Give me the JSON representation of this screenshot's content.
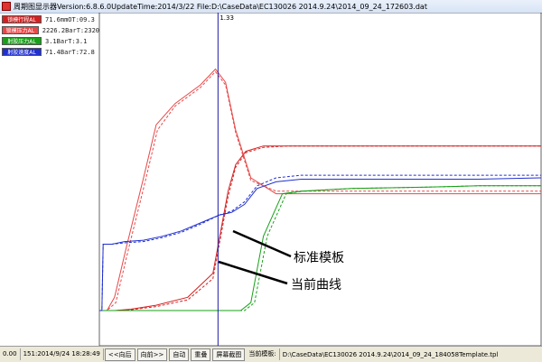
{
  "window": {
    "title": "周期图显示器Version:6.8.6.0UpdateTime:2014/3/22 File:D:\\CaseData\\EC130026 2014.9.24\\2014_09_24_172603.dat"
  },
  "legend": [
    {
      "name": "锁模行程AL",
      "value": "71.6mmOT:09.3",
      "color": "#d42020"
    },
    {
      "name": "锁模压力AL",
      "value": "2226.2BarT:2320",
      "color": "#e84848"
    },
    {
      "name": "射胶压力AL",
      "value": "3.1BarT:3.1",
      "color": "#18a018"
    },
    {
      "name": "射胶速度AL",
      "value": "71.4BarT:72.8",
      "color": "#2030d0"
    }
  ],
  "cursor": {
    "label": "1.33",
    "x": 0.94
  },
  "annotations": {
    "template": "标准模板",
    "current": "当前曲线"
  },
  "status": {
    "zero": "0.00",
    "time": "151:2014/9/24 18:28:49",
    "btn_back": "<<向后",
    "btn_forward": "向前>>",
    "btn_auto": "自动",
    "btn_overlay": "重叠",
    "btn_screenshot": "屏幕截图",
    "template_label": "当前模板:",
    "template_path": "D:\\CaseData\\EC130026 2014.9.24\\2014_09_24_184058Template.tpl"
  },
  "chart_data": {
    "type": "line",
    "title": "",
    "xlabel": "",
    "ylabel": "",
    "xlim": [
      0,
      3.5
    ],
    "ylim": [
      0,
      100
    ],
    "grid": false,
    "legend_position": "top-left",
    "series": [
      {
        "name": "锁模行程AL",
        "color": "#d42020",
        "style": "solid",
        "x": [
          0,
          0.05,
          0.12,
          0.25,
          0.45,
          0.7,
          0.9,
          0.97,
          1.02,
          1.08,
          1.16,
          1.3,
          1.5,
          1.8,
          2.4,
          3.0,
          3.5
        ],
        "y": [
          0,
          0,
          0,
          0.5,
          2,
          5,
          14,
          32,
          45,
          55,
          60,
          62,
          62,
          62,
          62,
          62,
          62
        ]
      },
      {
        "name": "锁模行程AL",
        "color": "#d42020",
        "style": "dashed",
        "x": [
          0,
          0.05,
          0.12,
          0.25,
          0.45,
          0.7,
          0.9,
          0.97,
          1.02,
          1.08,
          1.16,
          1.3,
          1.5,
          1.8,
          2.4,
          3.0,
          3.5
        ],
        "y": [
          0,
          0,
          0,
          0.3,
          1.5,
          4,
          12,
          30,
          43,
          54,
          59.5,
          61.5,
          62,
          62,
          62,
          62,
          62
        ]
      },
      {
        "name": "锁模压力AL",
        "color": "#e84848",
        "style": "solid",
        "x": [
          0,
          0.06,
          0.12,
          0.22,
          0.35,
          0.45,
          0.6,
          0.8,
          0.92,
          1.0,
          1.08,
          1.2,
          1.4,
          1.6,
          2.0,
          2.6,
          3.0,
          3.5
        ],
        "y": [
          0,
          0,
          5,
          25,
          50,
          70,
          78,
          85,
          91,
          86,
          68,
          50,
          44,
          44,
          44,
          44,
          44,
          44
        ]
      },
      {
        "name": "锁模压力AL",
        "color": "#e84848",
        "style": "dashed",
        "x": [
          0,
          0.06,
          0.13,
          0.23,
          0.36,
          0.46,
          0.6,
          0.8,
          0.92,
          1.0,
          1.08,
          1.2,
          1.4,
          1.6,
          2.0,
          2.6,
          3.0,
          3.5
        ],
        "y": [
          0,
          0,
          3,
          23,
          48,
          68,
          77,
          84,
          90,
          85,
          67,
          49,
          45,
          45,
          45,
          45,
          45,
          45
        ]
      },
      {
        "name": "射胶压力AL",
        "color": "#18a018",
        "style": "solid",
        "x": [
          0,
          0.5,
          0.9,
          1.0,
          1.12,
          1.2,
          1.3,
          1.45,
          1.6,
          2.0,
          2.6,
          3.0,
          3.5
        ],
        "y": [
          0,
          0,
          0,
          0,
          0,
          3,
          28,
          44,
          45,
          46,
          46.5,
          47,
          47
        ]
      },
      {
        "name": "射胶压力AL",
        "color": "#18a018",
        "style": "dashed",
        "x": [
          0,
          0.5,
          0.9,
          1.0,
          1.15,
          1.23,
          1.33,
          1.48,
          1.62,
          2.0,
          2.6,
          3.0,
          3.5
        ],
        "y": [
          0,
          0,
          0,
          0,
          0,
          3,
          28,
          44,
          45,
          46,
          46.5,
          47,
          47
        ]
      },
      {
        "name": "射胶速度AL",
        "color": "#2030d0",
        "style": "solid",
        "x": [
          0,
          0.02,
          0.03,
          0.1,
          0.2,
          0.35,
          0.5,
          0.65,
          0.8,
          0.95,
          1.05,
          1.15,
          1.25,
          1.4,
          1.6,
          2.0,
          2.6,
          3.0,
          3.5
        ],
        "y": [
          0,
          0,
          25,
          25,
          26,
          26.5,
          28,
          30,
          33,
          36,
          37,
          40,
          46,
          48.5,
          49.5,
          49.5,
          49.5,
          49.5,
          50
        ]
      },
      {
        "name": "射胶速度AL",
        "color": "#2030d0",
        "style": "dashed",
        "x": [
          0,
          0.02,
          0.03,
          0.1,
          0.2,
          0.35,
          0.5,
          0.65,
          0.8,
          0.95,
          1.05,
          1.15,
          1.25,
          1.4,
          1.6,
          2.0,
          2.6,
          3.0,
          3.5
        ],
        "y": [
          0,
          0,
          25,
          25,
          25.5,
          26,
          27.5,
          29.5,
          32.5,
          36,
          37.5,
          41,
          47,
          50,
          51,
          51,
          51,
          51,
          51
        ]
      }
    ]
  }
}
